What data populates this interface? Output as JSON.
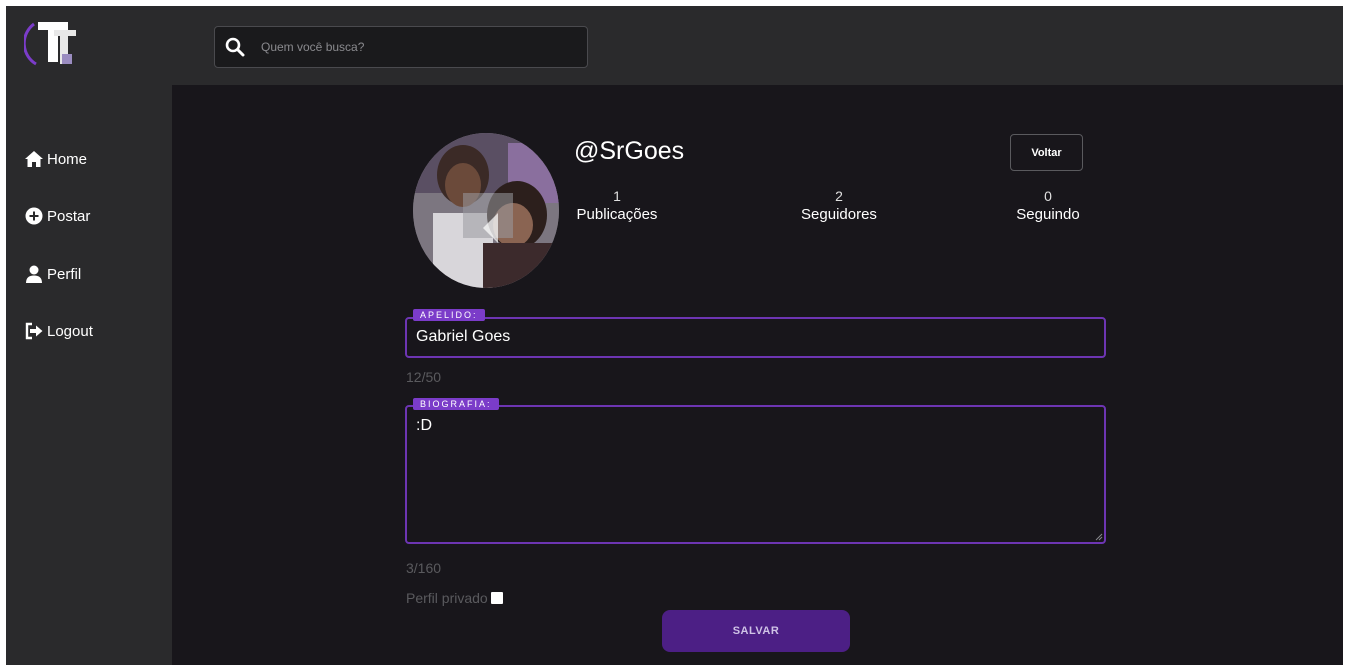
{
  "header": {
    "logo_icon": "tt-logo-icon",
    "search": {
      "placeholder": "Quem você busca?",
      "value": "",
      "icon": "search-icon"
    }
  },
  "sidebar": {
    "items": [
      {
        "label": "Home",
        "icon": "home-icon"
      },
      {
        "label": "Postar",
        "icon": "plus-circle-icon"
      },
      {
        "label": "Perfil",
        "icon": "user-icon"
      },
      {
        "label": "Logout",
        "icon": "logout-icon"
      }
    ]
  },
  "profile": {
    "username": "@SrGoes",
    "back_label": "Voltar",
    "stats": [
      {
        "value": "1",
        "label": "Publicações"
      },
      {
        "value": "2",
        "label": "Seguidores"
      },
      {
        "value": "0",
        "label": "Seguindo"
      }
    ]
  },
  "form": {
    "nickname": {
      "legend": "APELIDO:",
      "value": "Gabriel Goes",
      "counter": "12/50"
    },
    "bio": {
      "legend": "BIOGRAFIA:",
      "value": ":D",
      "counter": "3/160"
    },
    "private_label": "Perfil privado",
    "private_checked": false,
    "save_label": "SALVAR"
  },
  "colors": {
    "accent": "#6d35b3",
    "legend_bg": "#7b3cc9",
    "save_bg": "#4c1f85",
    "panel_bg": "#2a2a2c",
    "main_bg": "#18161b"
  }
}
